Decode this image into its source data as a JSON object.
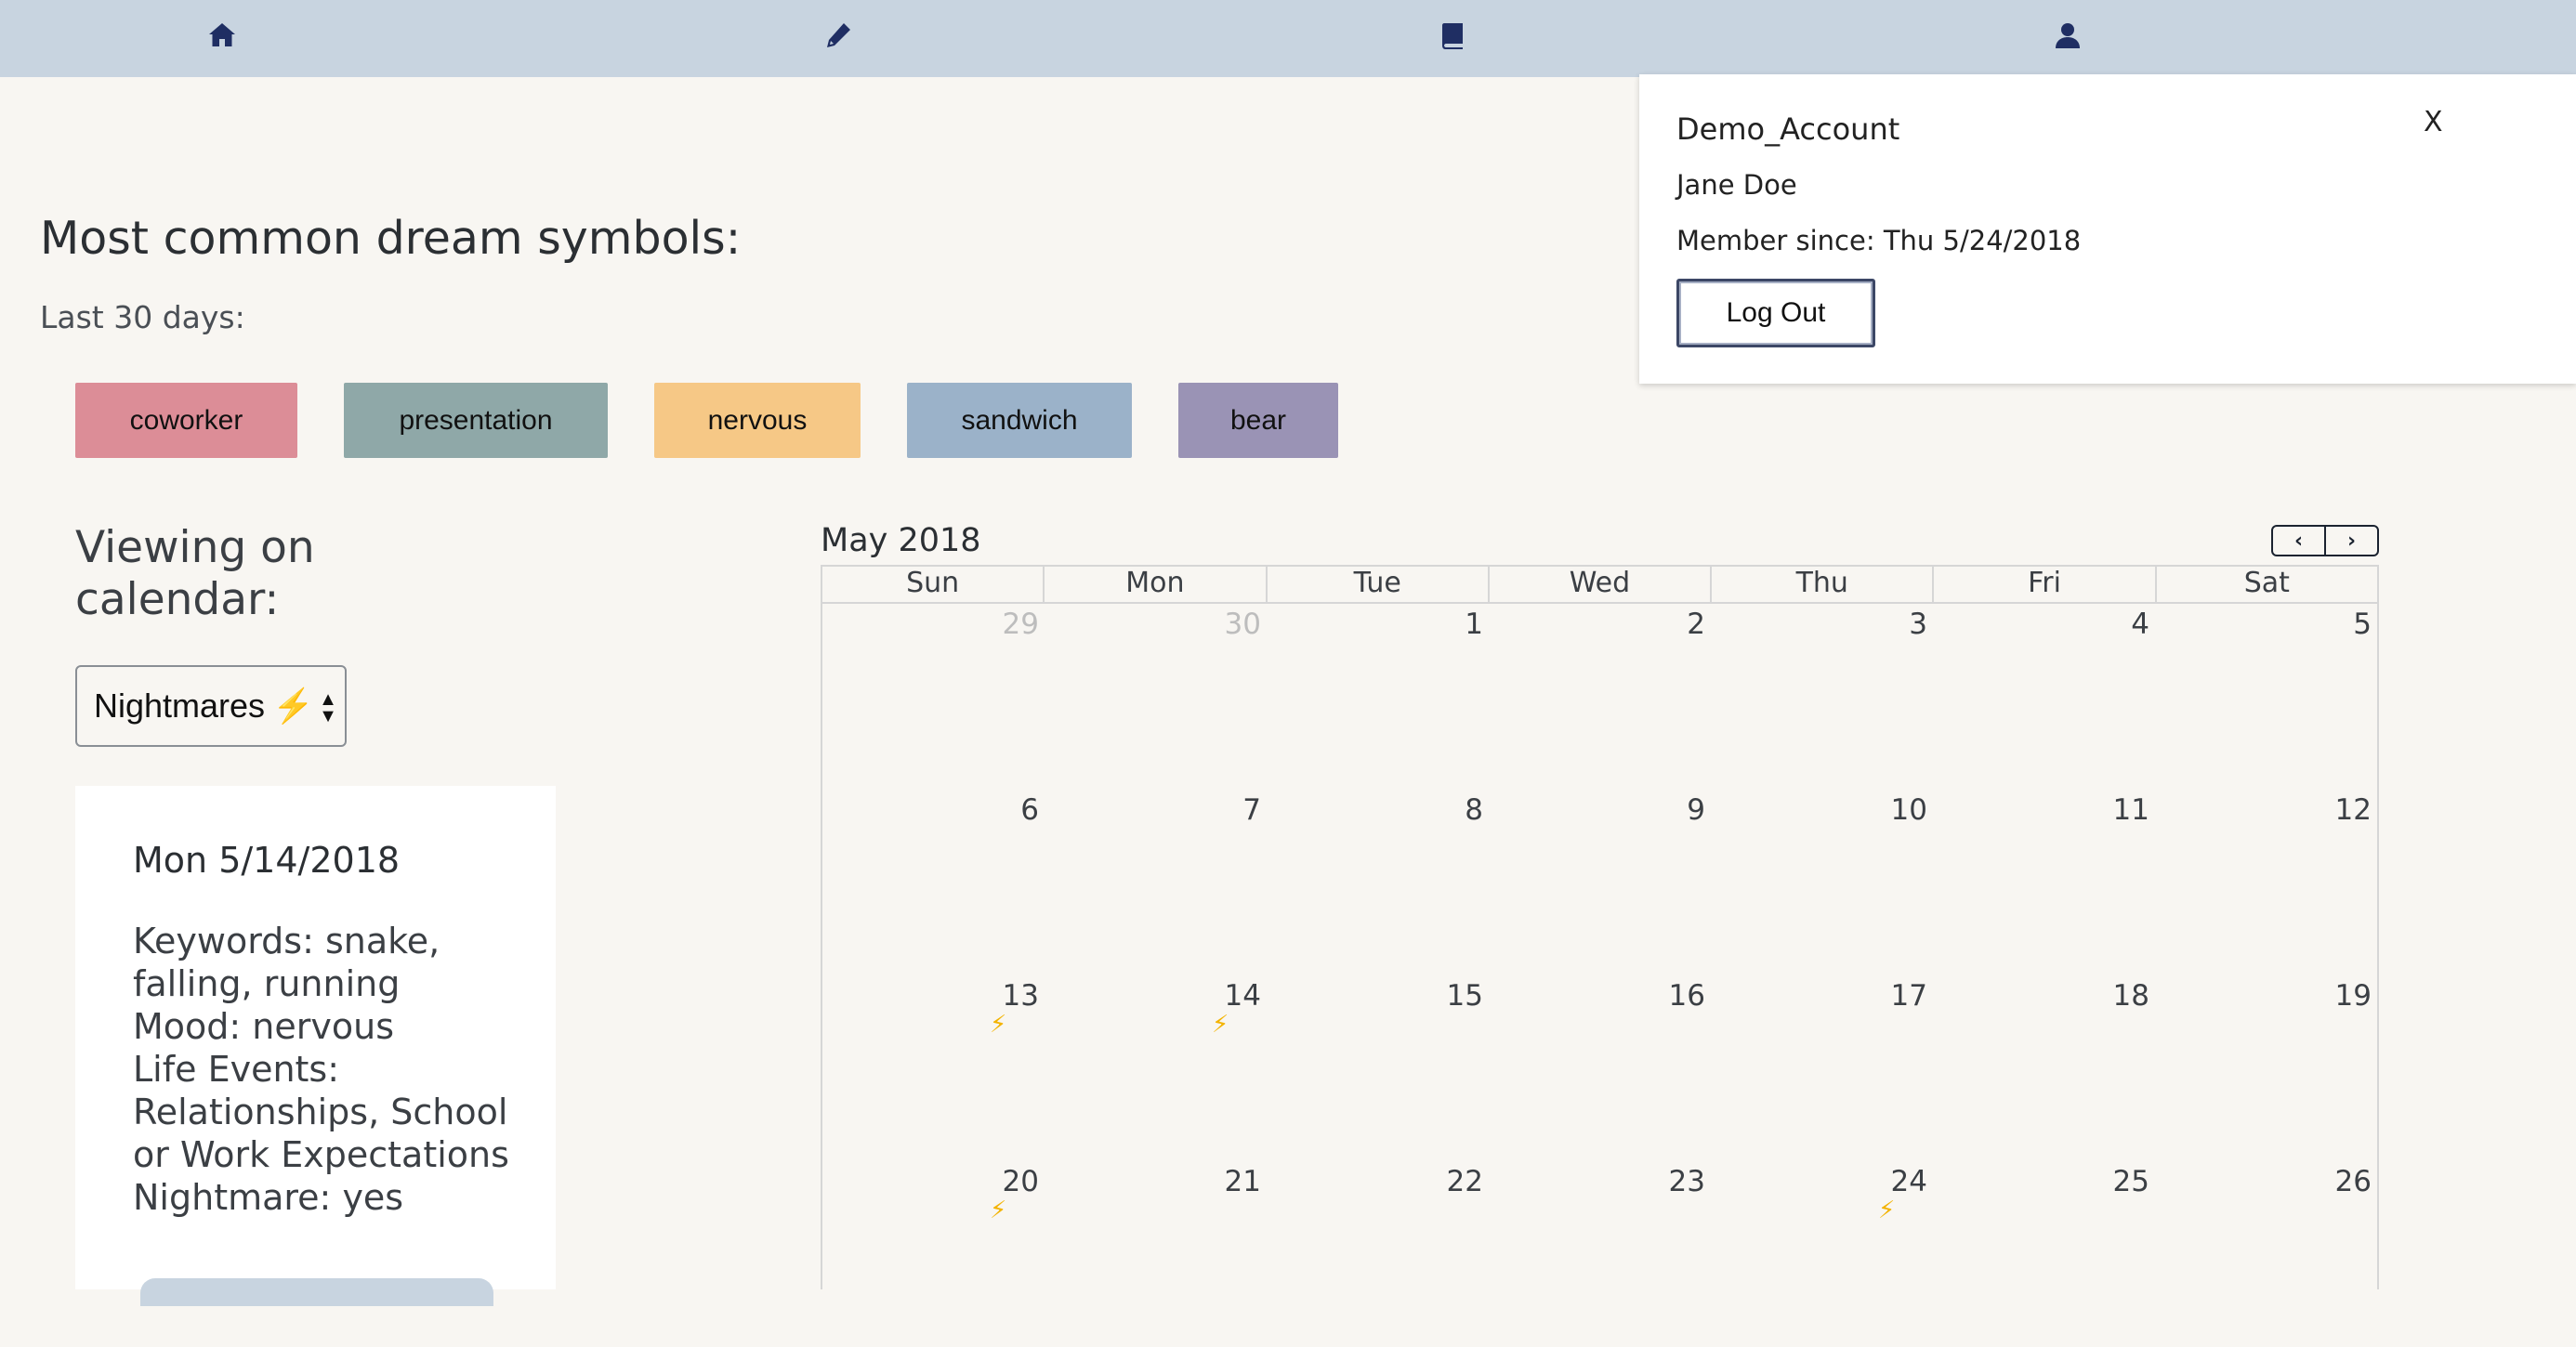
{
  "nav": {
    "items": [
      {
        "icon": "home-icon"
      },
      {
        "icon": "pencil-icon"
      },
      {
        "icon": "book-icon"
      },
      {
        "icon": "user-icon"
      }
    ],
    "color": "#1f2e63"
  },
  "symbols": {
    "title": "Most common dream symbols:",
    "subtitle": "Last 30 days:",
    "chips": [
      {
        "label": "coworker",
        "color": "#dc8d97"
      },
      {
        "label": "presentation",
        "color": "#8fa8a8"
      },
      {
        "label": "nervous",
        "color": "#f6c886"
      },
      {
        "label": "sandwich",
        "color": "#9bb2c9"
      },
      {
        "label": "bear",
        "color": "#9a93b5"
      }
    ]
  },
  "calendar_filter": {
    "label": "Viewing on calendar:",
    "selected": "Nightmares",
    "selected_icon": "⚡"
  },
  "detail": {
    "date": "Mon 5/14/2018",
    "lines": [
      "Keywords: snake, falling, running",
      "Mood: nervous",
      "Life Events: Relationships, School or Work Expectations",
      "Nightmare: yes"
    ]
  },
  "calendar": {
    "title": "May 2018",
    "prev": "‹",
    "next": "›",
    "days_of_week": [
      "Sun",
      "Mon",
      "Tue",
      "Wed",
      "Thu",
      "Fri",
      "Sat"
    ],
    "weeks": [
      [
        {
          "n": "29",
          "muted": true
        },
        {
          "n": "30",
          "muted": true
        },
        {
          "n": "1"
        },
        {
          "n": "2"
        },
        {
          "n": "3"
        },
        {
          "n": "4"
        },
        {
          "n": "5"
        }
      ],
      [
        {
          "n": "6"
        },
        {
          "n": "7"
        },
        {
          "n": "8"
        },
        {
          "n": "9"
        },
        {
          "n": "10"
        },
        {
          "n": "11"
        },
        {
          "n": "12"
        }
      ],
      [
        {
          "n": "13",
          "event": true
        },
        {
          "n": "14",
          "event": true
        },
        {
          "n": "15"
        },
        {
          "n": "16"
        },
        {
          "n": "17"
        },
        {
          "n": "18"
        },
        {
          "n": "19"
        }
      ],
      [
        {
          "n": "20",
          "event": true
        },
        {
          "n": "21"
        },
        {
          "n": "22"
        },
        {
          "n": "23"
        },
        {
          "n": "24",
          "event": true
        },
        {
          "n": "25"
        },
        {
          "n": "26"
        }
      ]
    ],
    "event_symbol": "⚡",
    "event_color": "#f3b300"
  },
  "account_popup": {
    "username": "Demo_Account",
    "close_label": "X",
    "full_name": "Jane Doe",
    "member_since": "Member since: Thu 5/24/2018",
    "logout_label": "Log Out"
  }
}
